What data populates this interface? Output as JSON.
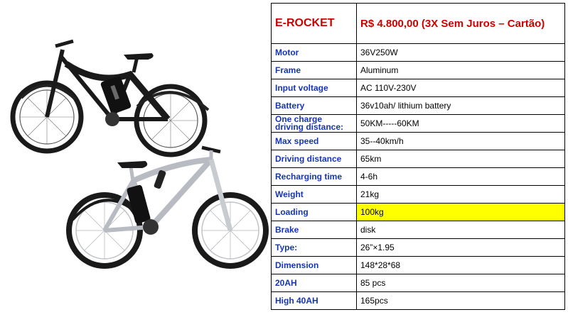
{
  "product": {
    "name": "E-ROCKET",
    "price": "R$ 4.800,00 (3X Sem Juros – Cartão)"
  },
  "images": [
    {
      "name": "black-electric-bike",
      "color": "#1a1a1a"
    },
    {
      "name": "silver-electric-bike",
      "color": "#b8bcc2"
    }
  ],
  "specs": [
    {
      "label": "Motor",
      "value": "36V250W"
    },
    {
      "label": "Frame",
      "value": "Aluminum"
    },
    {
      "label": "Input voltage",
      "value": "AC 110V-230V"
    },
    {
      "label": "Battery",
      "value": "36v10ah/ lithium battery"
    },
    {
      "label": "One charge driving distance:",
      "value": "50KM-----60KM"
    },
    {
      "label": "Max speed",
      "value": "35--40km/h"
    },
    {
      "label": "Driving distance",
      "value": "65km"
    },
    {
      "label": "Recharging time",
      "value": "4-6h"
    },
    {
      "label": "Weight",
      "value": "21kg"
    },
    {
      "label": "Loading",
      "value": "100kg",
      "highlight": true
    },
    {
      "label": "Brake",
      "value": "disk"
    },
    {
      "label": "Type:",
      "value": "26”×1.95"
    },
    {
      "label": "Dimension",
      "value": "148*28*68"
    },
    {
      "label": "20AH",
      "value": "85 pcs"
    },
    {
      "label": "High 40AH",
      "value": "165pcs"
    }
  ],
  "colors": {
    "label_blue": "#1535b5",
    "header_red": "#d10000",
    "highlight_yellow": "#ffff00"
  }
}
